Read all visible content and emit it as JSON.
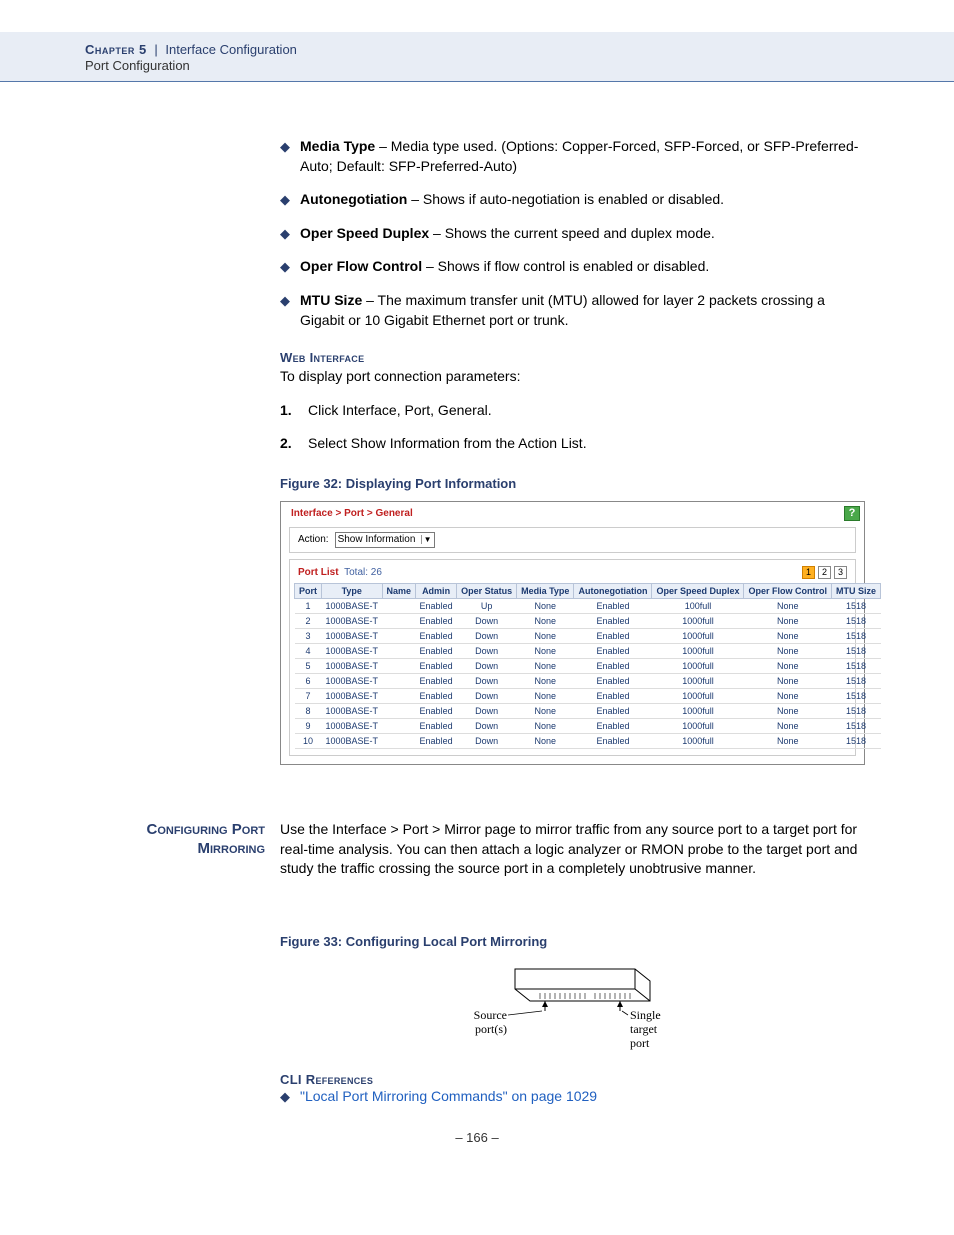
{
  "header": {
    "chapter_label": "Chapter 5",
    "separator": "|",
    "chapter_title": "Interface Configuration",
    "subtitle": "Port Configuration"
  },
  "bullets": [
    {
      "term": "Media Type",
      "desc": " – Media type used. (Options: Copper-Forced, SFP-Forced, or SFP-Preferred-Auto; Default: SFP-Preferred-Auto)"
    },
    {
      "term": "Autonegotiation",
      "desc": " – Shows if auto-negotiation is enabled or disabled."
    },
    {
      "term": "Oper Speed Duplex",
      "desc": " – Shows the current speed and duplex mode."
    },
    {
      "term": "Oper Flow Control",
      "desc": " – Shows if flow control is enabled or disabled."
    },
    {
      "term": "MTU Size",
      "desc": " – The maximum transfer unit (MTU) allowed for layer 2 packets crossing a Gigabit or 10 Gigabit Ethernet port or trunk."
    }
  ],
  "web_interface": {
    "heading": "Web Interface",
    "intro": "To display port connection parameters:",
    "steps": [
      "Click Interface, Port, General.",
      "Select Show Information from the Action List."
    ]
  },
  "figure32": {
    "caption": "Figure 32:  Displaying Port Information",
    "breadcrumb": "Interface > Port > General",
    "action_label": "Action:",
    "action_value": "Show Information",
    "port_list_label": "Port List",
    "total_label": "Total: 26",
    "pager": [
      "1",
      "2",
      "3"
    ],
    "columns": [
      "Port",
      "Type",
      "Name",
      "Admin",
      "Oper Status",
      "Media Type",
      "Autonegotiation",
      "Oper Speed Duplex",
      "Oper Flow Control",
      "MTU Size"
    ],
    "rows": [
      [
        "1",
        "1000BASE-T",
        "",
        "Enabled",
        "Up",
        "None",
        "Enabled",
        "100full",
        "None",
        "1518"
      ],
      [
        "2",
        "1000BASE-T",
        "",
        "Enabled",
        "Down",
        "None",
        "Enabled",
        "1000full",
        "None",
        "1518"
      ],
      [
        "3",
        "1000BASE-T",
        "",
        "Enabled",
        "Down",
        "None",
        "Enabled",
        "1000full",
        "None",
        "1518"
      ],
      [
        "4",
        "1000BASE-T",
        "",
        "Enabled",
        "Down",
        "None",
        "Enabled",
        "1000full",
        "None",
        "1518"
      ],
      [
        "5",
        "1000BASE-T",
        "",
        "Enabled",
        "Down",
        "None",
        "Enabled",
        "1000full",
        "None",
        "1518"
      ],
      [
        "6",
        "1000BASE-T",
        "",
        "Enabled",
        "Down",
        "None",
        "Enabled",
        "1000full",
        "None",
        "1518"
      ],
      [
        "7",
        "1000BASE-T",
        "",
        "Enabled",
        "Down",
        "None",
        "Enabled",
        "1000full",
        "None",
        "1518"
      ],
      [
        "8",
        "1000BASE-T",
        "",
        "Enabled",
        "Down",
        "None",
        "Enabled",
        "1000full",
        "None",
        "1518"
      ],
      [
        "9",
        "1000BASE-T",
        "",
        "Enabled",
        "Down",
        "None",
        "Enabled",
        "1000full",
        "None",
        "1518"
      ],
      [
        "10",
        "1000BASE-T",
        "",
        "Enabled",
        "Down",
        "None",
        "Enabled",
        "1000full",
        "None",
        "1518"
      ]
    ]
  },
  "mirroring": {
    "side_heading": "Configuring Port Mirroring",
    "body": "Use the Interface > Port > Mirror page to mirror traffic from any source port to a target port for real-time analysis. You can then attach a logic analyzer or RMON probe to the target port and study the traffic crossing the source port in a completely unobtrusive manner."
  },
  "figure33": {
    "caption": "Figure 33:  Configuring Local Port Mirroring",
    "left_label": "Source port(s)",
    "right_label": "Single target port"
  },
  "cli": {
    "heading": "CLI References",
    "link": "\"Local Port Mirroring Commands\" on page 1029"
  },
  "page_number": "–  166  –"
}
